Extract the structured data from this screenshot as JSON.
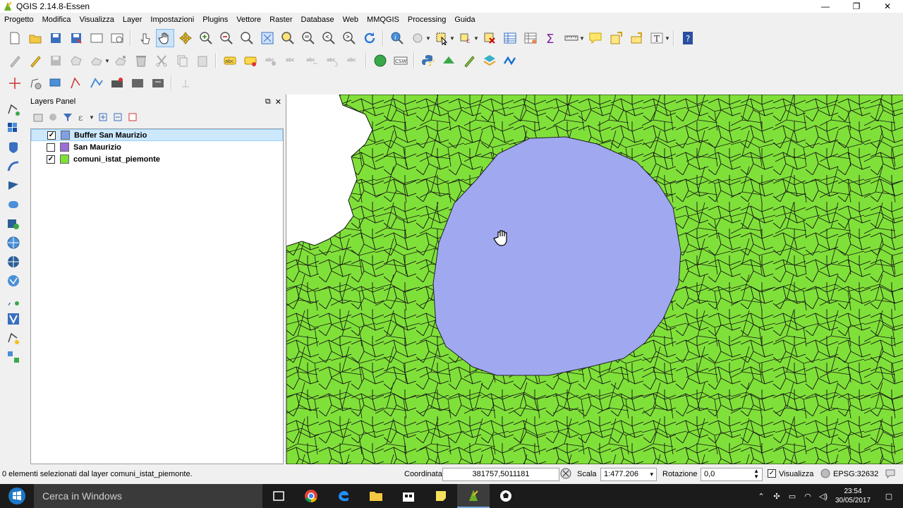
{
  "window": {
    "title": "QGIS 2.14.8-Essen",
    "controls": [
      "—",
      "❐",
      "✕"
    ]
  },
  "menu": [
    "Progetto",
    "Modifica",
    "Visualizza",
    "Layer",
    "Impostazioni",
    "Plugins",
    "Vettore",
    "Raster",
    "Database",
    "Web",
    "MMQGIS",
    "Processing",
    "Guida"
  ],
  "layers_panel": {
    "title": "Layers Panel",
    "layers": [
      {
        "name": "Buffer San Maurizio",
        "checked": true,
        "color": "#7f9fe6",
        "selected": true
      },
      {
        "name": "San Maurizio",
        "checked": false,
        "color": "#9b6fd6",
        "selected": false
      },
      {
        "name": "comuni_istat_piemonte",
        "checked": true,
        "color": "#80e03a",
        "selected": false
      }
    ]
  },
  "map": {
    "background": "#80e03a",
    "buffer_fill": "#a0a8f0",
    "cursor": "pan-hand"
  },
  "status": {
    "message": "0 elementi selezionati dal layer comuni_istat_piemonte.",
    "coord_label": "Coordinata",
    "coord_value": "381757,5011181",
    "scale_label": "Scala",
    "scale_value": "1:477.206",
    "rotation_label": "Rotazione",
    "rotation_value": "0,0",
    "render_label": "Visualizza",
    "crs": "EPSG:32632"
  },
  "taskbar": {
    "search_placeholder": "Cerca in Windows",
    "time": "23:54",
    "date": "30/05/2017"
  }
}
